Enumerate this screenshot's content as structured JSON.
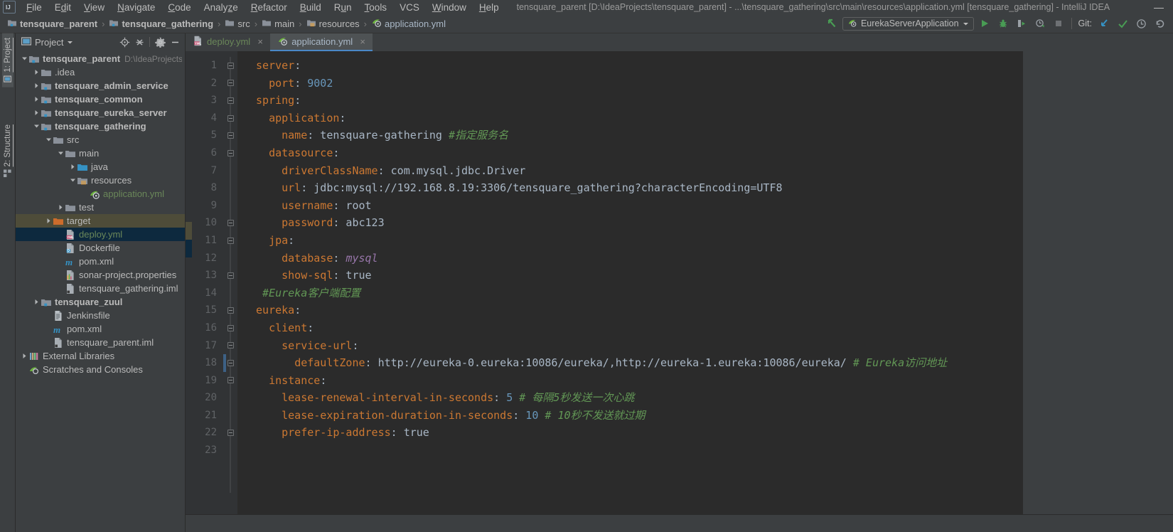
{
  "window": {
    "title": "tensquare_parent [D:\\IdeaProjects\\tensquare_parent] - ...\\tensquare_gathering\\src\\main\\resources\\application.yml [tensquare_gathering] - IntelliJ IDEA",
    "minimize_label": "—"
  },
  "menu": {
    "items": [
      {
        "label": "File",
        "mnemonic": "F"
      },
      {
        "label": "Edit",
        "mnemonic": "E"
      },
      {
        "label": "View",
        "mnemonic": "V"
      },
      {
        "label": "Navigate",
        "mnemonic": "N"
      },
      {
        "label": "Code",
        "mnemonic": "C"
      },
      {
        "label": "Analyze",
        "mnemonic": "z"
      },
      {
        "label": "Refactor",
        "mnemonic": "R"
      },
      {
        "label": "Build",
        "mnemonic": "B"
      },
      {
        "label": "Run",
        "mnemonic": "u"
      },
      {
        "label": "Tools",
        "mnemonic": "T"
      },
      {
        "label": "VCS",
        "mnemonic": "V"
      },
      {
        "label": "Window",
        "mnemonic": "W"
      },
      {
        "label": "Help",
        "mnemonic": "H"
      }
    ]
  },
  "breadcrumb": {
    "items": [
      {
        "label": "tensquare_parent",
        "icon": "module-icon",
        "style": "bold"
      },
      {
        "label": "tensquare_gathering",
        "icon": "module-icon",
        "style": "bold"
      },
      {
        "label": "src",
        "icon": "folder-icon",
        "style": "normal"
      },
      {
        "label": "main",
        "icon": "folder-icon",
        "style": "normal"
      },
      {
        "label": "resources",
        "icon": "resources-folder-icon",
        "style": "normal"
      },
      {
        "label": "application.yml",
        "icon": "spring-yml-icon",
        "style": "file"
      }
    ],
    "separator": "›"
  },
  "toolbar": {
    "run_config": "EurekaServerApplication",
    "git_label": "Git:",
    "buttons": [
      {
        "name": "back-arrow-icon",
        "title": "Back"
      },
      {
        "name": "run-button",
        "title": "Run"
      },
      {
        "name": "debug-button",
        "title": "Debug"
      },
      {
        "name": "run-coverage-button",
        "title": "Run with Coverage"
      },
      {
        "name": "profile-button",
        "title": "Profile"
      },
      {
        "name": "stop-button",
        "title": "Stop"
      },
      {
        "name": "git-update-button",
        "title": "Update Project"
      },
      {
        "name": "git-commit-button",
        "title": "Commit"
      },
      {
        "name": "git-history-button",
        "title": "History"
      },
      {
        "name": "git-rollback-button",
        "title": "Rollback"
      }
    ]
  },
  "stripe": {
    "project": "1: Project",
    "structure": "2: Structure"
  },
  "project_panel": {
    "title": "Project",
    "actions": [
      "locate-icon",
      "collapse-all-icon",
      "gear-icon",
      "hide-icon"
    ],
    "tree": [
      {
        "depth": 0,
        "label": "tensquare_parent",
        "icon": "module-icon",
        "arrow": "down",
        "bold": true,
        "hint": "D:\\IdeaProjects\\te",
        "state": "normal"
      },
      {
        "depth": 1,
        "label": ".idea",
        "icon": "folder-icon",
        "arrow": "right",
        "bold": false,
        "hint": "",
        "state": "normal"
      },
      {
        "depth": 1,
        "label": "tensquare_admin_service",
        "icon": "module-icon",
        "arrow": "right",
        "bold": true,
        "hint": "",
        "state": "normal"
      },
      {
        "depth": 1,
        "label": "tensquare_common",
        "icon": "module-icon",
        "arrow": "right",
        "bold": true,
        "hint": "",
        "state": "normal"
      },
      {
        "depth": 1,
        "label": "tensquare_eureka_server",
        "icon": "module-icon",
        "arrow": "right",
        "bold": true,
        "hint": "",
        "state": "normal"
      },
      {
        "depth": 1,
        "label": "tensquare_gathering",
        "icon": "module-icon",
        "arrow": "down",
        "bold": true,
        "hint": "",
        "state": "normal"
      },
      {
        "depth": 2,
        "label": "src",
        "icon": "folder-icon",
        "arrow": "down",
        "bold": false,
        "hint": "",
        "state": "normal"
      },
      {
        "depth": 3,
        "label": "main",
        "icon": "folder-icon",
        "arrow": "down",
        "bold": false,
        "hint": "",
        "state": "normal"
      },
      {
        "depth": 4,
        "label": "java",
        "icon": "source-folder-icon",
        "arrow": "right",
        "bold": false,
        "hint": "",
        "state": "normal"
      },
      {
        "depth": 4,
        "label": "resources",
        "icon": "resources-folder-icon",
        "arrow": "down",
        "bold": false,
        "hint": "",
        "state": "normal"
      },
      {
        "depth": 5,
        "label": "application.yml",
        "icon": "spring-yml-icon",
        "arrow": "none",
        "bold": false,
        "hint": "",
        "state": "normal",
        "color": "green"
      },
      {
        "depth": 3,
        "label": "test",
        "icon": "folder-icon",
        "arrow": "right",
        "bold": false,
        "hint": "",
        "state": "normal"
      },
      {
        "depth": 2,
        "label": "target",
        "icon": "target-folder-icon",
        "arrow": "right",
        "bold": false,
        "hint": "",
        "state": "highlight"
      },
      {
        "depth": 3,
        "label": "deploy.yml",
        "icon": "yml-file-icon",
        "arrow": "none",
        "bold": false,
        "hint": "",
        "state": "selected",
        "color": "green"
      },
      {
        "depth": 3,
        "label": "Dockerfile",
        "icon": "docker-file-icon",
        "arrow": "none",
        "bold": false,
        "hint": "",
        "state": "normal"
      },
      {
        "depth": 3,
        "label": "pom.xml",
        "icon": "maven-icon",
        "arrow": "none",
        "bold": false,
        "hint": "",
        "state": "normal"
      },
      {
        "depth": 3,
        "label": "sonar-project.properties",
        "icon": "properties-file-icon",
        "arrow": "none",
        "bold": false,
        "hint": "",
        "state": "normal"
      },
      {
        "depth": 3,
        "label": "tensquare_gathering.iml",
        "icon": "iml-file-icon",
        "arrow": "none",
        "bold": false,
        "hint": "",
        "state": "normal"
      },
      {
        "depth": 1,
        "label": "tensquare_zuul",
        "icon": "module-icon",
        "arrow": "right",
        "bold": true,
        "hint": "",
        "state": "normal"
      },
      {
        "depth": 2,
        "label": "Jenkinsfile",
        "icon": "text-file-icon",
        "arrow": "none",
        "bold": false,
        "hint": "",
        "state": "normal"
      },
      {
        "depth": 2,
        "label": "pom.xml",
        "icon": "maven-icon",
        "arrow": "none",
        "bold": false,
        "hint": "",
        "state": "normal"
      },
      {
        "depth": 2,
        "label": "tensquare_parent.iml",
        "icon": "iml-file-icon",
        "arrow": "none",
        "bold": false,
        "hint": "",
        "state": "normal"
      },
      {
        "depth": 0,
        "label": "External Libraries",
        "icon": "libraries-icon",
        "arrow": "right",
        "bold": false,
        "hint": "",
        "state": "normal"
      },
      {
        "depth": 0,
        "label": "Scratches and Consoles",
        "icon": "scratches-icon",
        "arrow": "none",
        "bold": false,
        "hint": "",
        "state": "normal"
      }
    ]
  },
  "editor": {
    "tabs": [
      {
        "label": "deploy.yml",
        "icon": "yml-file-icon",
        "active": false,
        "close": "×"
      },
      {
        "label": "application.yml",
        "icon": "spring-yml-icon",
        "active": true,
        "close": "×"
      }
    ],
    "line_numbers": [
      "1",
      "2",
      "3",
      "4",
      "5",
      "6",
      "7",
      "8",
      "9",
      "10",
      "11",
      "12",
      "13",
      "14",
      "15",
      "16",
      "17",
      "18",
      "19",
      "20",
      "21",
      "22",
      "23"
    ],
    "lines": [
      {
        "n": 1,
        "indent": 0,
        "fold": "top",
        "tokens": [
          {
            "t": "server",
            "c": "k"
          },
          {
            "t": ":",
            "c": "plain"
          }
        ]
      },
      {
        "n": 2,
        "indent": 1,
        "fold": "end",
        "tokens": [
          {
            "t": "port",
            "c": "k"
          },
          {
            "t": ": ",
            "c": "plain"
          },
          {
            "t": "9002",
            "c": "num"
          }
        ]
      },
      {
        "n": 3,
        "indent": 0,
        "fold": "top",
        "tokens": [
          {
            "t": "spring",
            "c": "k"
          },
          {
            "t": ":",
            "c": "plain"
          }
        ]
      },
      {
        "n": 4,
        "indent": 1,
        "fold": "top",
        "tokens": [
          {
            "t": "application",
            "c": "k"
          },
          {
            "t": ":",
            "c": "plain"
          }
        ]
      },
      {
        "n": 5,
        "indent": 2,
        "fold": "end",
        "tokens": [
          {
            "t": "name",
            "c": "k"
          },
          {
            "t": ": tensquare-gathering ",
            "c": "plain"
          },
          {
            "t": "#指定服务名",
            "c": "cm"
          }
        ]
      },
      {
        "n": 6,
        "indent": 1,
        "fold": "top",
        "tokens": [
          {
            "t": "datasource",
            "c": "k"
          },
          {
            "t": ":",
            "c": "plain"
          }
        ]
      },
      {
        "n": 7,
        "indent": 2,
        "fold": "none",
        "tokens": [
          {
            "t": "driverClassName",
            "c": "k"
          },
          {
            "t": ": com.mysql.jdbc.Driver",
            "c": "plain"
          }
        ]
      },
      {
        "n": 8,
        "indent": 2,
        "fold": "none",
        "tokens": [
          {
            "t": "url",
            "c": "k"
          },
          {
            "t": ": jdbc:mysql://192.168.8.19:3306/tensquare_gathering?characterEncoding=UTF8",
            "c": "plain"
          }
        ]
      },
      {
        "n": 9,
        "indent": 2,
        "fold": "none",
        "tokens": [
          {
            "t": "username",
            "c": "k"
          },
          {
            "t": ": root",
            "c": "plain"
          }
        ]
      },
      {
        "n": 10,
        "indent": 2,
        "fold": "end",
        "tokens": [
          {
            "t": "password",
            "c": "k"
          },
          {
            "t": ": abc123",
            "c": "plain"
          }
        ]
      },
      {
        "n": 11,
        "indent": 1,
        "fold": "top",
        "tokens": [
          {
            "t": "jpa",
            "c": "k"
          },
          {
            "t": ":",
            "c": "plain"
          }
        ]
      },
      {
        "n": 12,
        "indent": 2,
        "fold": "none",
        "tokens": [
          {
            "t": "database",
            "c": "k"
          },
          {
            "t": ": ",
            "c": "plain"
          },
          {
            "t": "mysql",
            "c": "val-i"
          }
        ]
      },
      {
        "n": 13,
        "indent": 2,
        "fold": "end",
        "tokens": [
          {
            "t": "show-sql",
            "c": "k"
          },
          {
            "t": ": true",
            "c": "plain"
          }
        ]
      },
      {
        "n": 14,
        "indent": 0,
        "fold": "none",
        "tokens": [
          {
            "t": " #Eureka客户端配置",
            "c": "cm"
          }
        ]
      },
      {
        "n": 15,
        "indent": 0,
        "fold": "top",
        "tokens": [
          {
            "t": "eureka",
            "c": "k"
          },
          {
            "t": ":",
            "c": "plain"
          }
        ]
      },
      {
        "n": 16,
        "indent": 1,
        "fold": "top",
        "tokens": [
          {
            "t": "client",
            "c": "k"
          },
          {
            "t": ":",
            "c": "plain"
          }
        ]
      },
      {
        "n": 17,
        "indent": 2,
        "fold": "top",
        "tokens": [
          {
            "t": "service-url",
            "c": "k"
          },
          {
            "t": ":",
            "c": "plain"
          }
        ]
      },
      {
        "n": 18,
        "indent": 3,
        "fold": "end-hl",
        "tokens": [
          {
            "t": "defaultZone",
            "c": "k"
          },
          {
            "t": ": http://eureka-0.eureka:10086/eureka/,http://eureka-1.eureka:10086/eureka/ ",
            "c": "plain"
          },
          {
            "t": "# Eureka访问地址",
            "c": "cm"
          }
        ]
      },
      {
        "n": 19,
        "indent": 1,
        "fold": "top",
        "tokens": [
          {
            "t": "instance",
            "c": "k"
          },
          {
            "t": ":",
            "c": "plain"
          }
        ]
      },
      {
        "n": 20,
        "indent": 2,
        "fold": "none",
        "tokens": [
          {
            "t": "lease-renewal-interval-in-seconds",
            "c": "k"
          },
          {
            "t": ": ",
            "c": "plain"
          },
          {
            "t": "5",
            "c": "num"
          },
          {
            "t": " ",
            "c": "plain"
          },
          {
            "t": "# 每隔5秒发送一次心跳",
            "c": "cm"
          }
        ]
      },
      {
        "n": 21,
        "indent": 2,
        "fold": "none",
        "tokens": [
          {
            "t": "lease-expiration-duration-in-seconds",
            "c": "k"
          },
          {
            "t": ": ",
            "c": "plain"
          },
          {
            "t": "10",
            "c": "num"
          },
          {
            "t": " ",
            "c": "plain"
          },
          {
            "t": "# 10秒不发送就过期",
            "c": "cm"
          }
        ]
      },
      {
        "n": 22,
        "indent": 2,
        "fold": "end",
        "tokens": [
          {
            "t": "prefer-ip-address",
            "c": "k"
          },
          {
            "t": ": true",
            "c": "plain"
          }
        ]
      },
      {
        "n": 23,
        "indent": 0,
        "fold": "none",
        "tokens": []
      }
    ]
  },
  "colors": {
    "panel_bg": "#3c3f41",
    "editor_bg": "#2b2b2b",
    "gutter_bg": "#313335",
    "selection_blue": "#0d293e",
    "highlight_olive": "#4e4c39",
    "accent_blue": "#4a88c7",
    "keyword_orange": "#cc7832",
    "comment_green": "#629755",
    "number_blue": "#6897bb",
    "text_gray": "#a9b7c6",
    "run_green": "#499c54"
  }
}
